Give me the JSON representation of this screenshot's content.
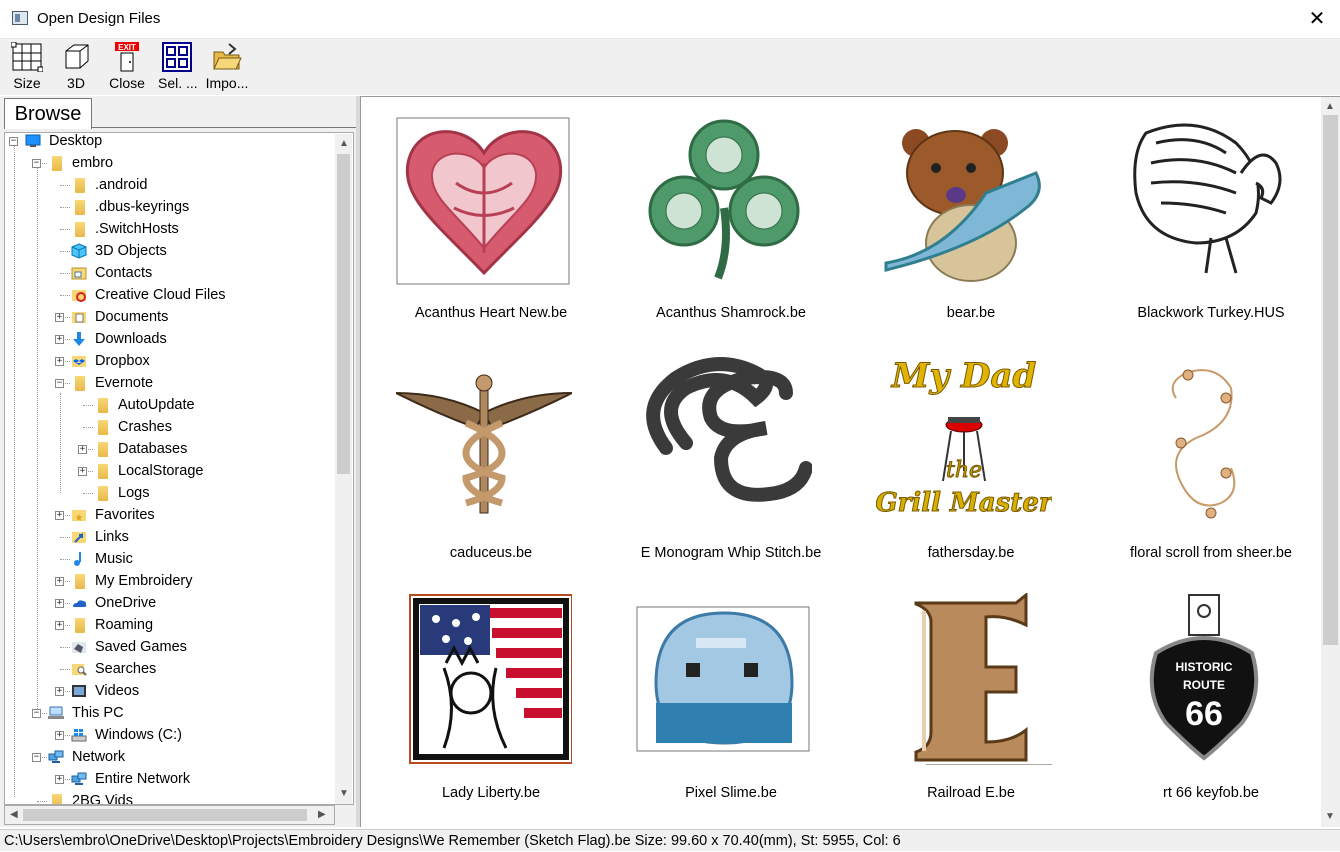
{
  "window": {
    "title": "Open Design Files",
    "close_glyph": "✕"
  },
  "toolbar": {
    "items": [
      {
        "label": "Size",
        "icon": "grid-resize-icon"
      },
      {
        "label": "3D",
        "icon": "cube-icon"
      },
      {
        "label": "Close",
        "icon": "exit-door-icon",
        "badge": "EXIT"
      },
      {
        "label": "Sel. ...",
        "icon": "select-grid-icon"
      },
      {
        "label": "Impo...",
        "icon": "open-folder-icon"
      }
    ]
  },
  "browser": {
    "tab_label": "Browse",
    "tree": [
      {
        "label": "Desktop",
        "icon": "desktop-icon",
        "expander": "−"
      },
      {
        "label": "embro",
        "icon": "folder-icon",
        "expander": "−"
      },
      {
        "label": ".android",
        "icon": "folder-icon"
      },
      {
        "label": ".dbus-keyrings",
        "icon": "folder-icon"
      },
      {
        "label": ".SwitchHosts",
        "icon": "folder-icon"
      },
      {
        "label": "3D Objects",
        "icon": "3d-objects-icon"
      },
      {
        "label": "Contacts",
        "icon": "contacts-icon"
      },
      {
        "label": "Creative Cloud Files",
        "icon": "creative-cloud-icon"
      },
      {
        "label": "Documents",
        "icon": "documents-icon",
        "expander": "+"
      },
      {
        "label": "Downloads",
        "icon": "downloads-icon",
        "expander": "+"
      },
      {
        "label": "Dropbox",
        "icon": "dropbox-icon",
        "expander": "+"
      },
      {
        "label": "Evernote",
        "icon": "folder-icon",
        "expander": "−"
      },
      {
        "label": "AutoUpdate",
        "icon": "folder-icon"
      },
      {
        "label": "Crashes",
        "icon": "folder-icon"
      },
      {
        "label": "Databases",
        "icon": "folder-icon",
        "expander": "+"
      },
      {
        "label": "LocalStorage",
        "icon": "folder-icon",
        "expander": "+"
      },
      {
        "label": "Logs",
        "icon": "folder-icon"
      },
      {
        "label": "Favorites",
        "icon": "favorites-icon",
        "expander": "+"
      },
      {
        "label": "Links",
        "icon": "links-icon"
      },
      {
        "label": "Music",
        "icon": "music-icon"
      },
      {
        "label": "My Embroidery",
        "icon": "folder-icon",
        "expander": "+"
      },
      {
        "label": "OneDrive",
        "icon": "onedrive-icon",
        "expander": "+"
      },
      {
        "label": "Roaming",
        "icon": "folder-icon",
        "expander": "+"
      },
      {
        "label": "Saved Games",
        "icon": "saved-games-icon"
      },
      {
        "label": "Searches",
        "icon": "searches-icon"
      },
      {
        "label": "Videos",
        "icon": "videos-icon",
        "expander": "+"
      },
      {
        "label": "This PC",
        "icon": "this-pc-icon",
        "expander": "−"
      },
      {
        "label": "Windows (C:)",
        "icon": "windows-drive-icon",
        "expander": "+"
      },
      {
        "label": "Network",
        "icon": "network-icon",
        "expander": "−"
      },
      {
        "label": "Entire Network",
        "icon": "network-icon",
        "expander": "+"
      },
      {
        "label": "2BG Vids",
        "icon": "folder-icon"
      }
    ]
  },
  "designs": [
    {
      "name": "Acanthus Heart New.be",
      "art": "heart"
    },
    {
      "name": "Acanthus Shamrock.be",
      "art": "shamrock"
    },
    {
      "name": "bear.be",
      "art": "bear"
    },
    {
      "name": "Blackwork Turkey.HUS",
      "art": "turkey"
    },
    {
      "name": "caduceus.be",
      "art": "caduceus"
    },
    {
      "name": "E Monogram Whip Stitch.be",
      "art": "monogram"
    },
    {
      "name": "fathersday.be",
      "art": "fathersday",
      "text1": "My Dad",
      "text2": "the",
      "text3": "Grill Master"
    },
    {
      "name": "floral scroll from sheer.be",
      "art": "scroll"
    },
    {
      "name": "Lady Liberty.be",
      "art": "liberty"
    },
    {
      "name": "Pixel Slime.be",
      "art": "slime"
    },
    {
      "name": "Railroad E.be",
      "art": "railroad"
    },
    {
      "name": "rt 66 keyfob.be",
      "art": "keyfob",
      "text1": "HISTORIC",
      "text2": "ROUTE",
      "text3": "66"
    }
  ],
  "status": {
    "text": "C:\\Users\\embro\\OneDrive\\Desktop\\Projects\\Embroidery Designs\\We Remember (Sketch Flag).be  Size: 99.60 x 70.40(mm), St: 5955, Col: 6"
  }
}
